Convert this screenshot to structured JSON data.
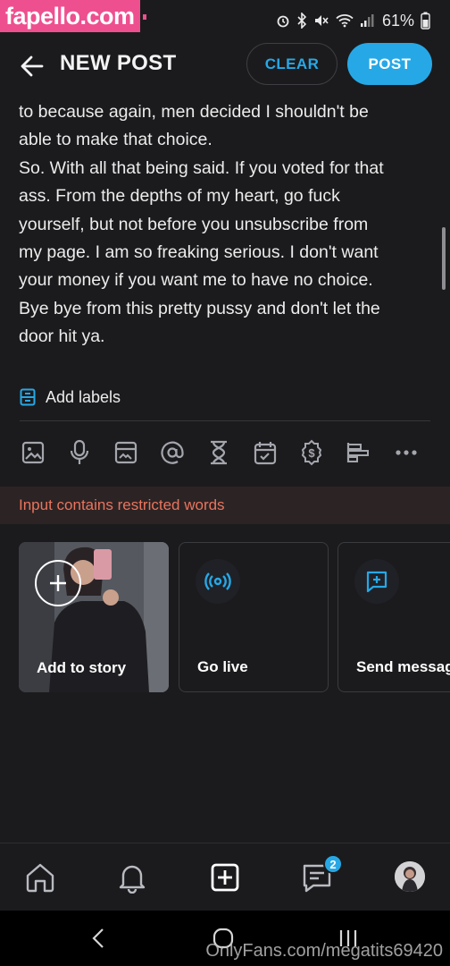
{
  "watermark": {
    "site": "fapello.com",
    "account": "OnlyFans.com/megatits69420"
  },
  "status_bar": {
    "battery": "61%"
  },
  "header": {
    "title": "NEW POST",
    "clear_label": "CLEAR",
    "post_label": "POST"
  },
  "post_text": {
    "lines": [
      "to because again, men decided I shouldn't be",
      "able to make that choice.",
      "So. With all that being said. If you voted for that",
      "ass. From the depths of my heart, go fuck",
      "yourself, but not before you unsubscribe from",
      "my page. I am so freaking serious. I don't want",
      "your money if you want me to have no choice.",
      "Bye bye from this pretty pussy and don't let the",
      "door hit ya."
    ]
  },
  "add_labels": "Add labels",
  "toolbar_icons": [
    "image-icon",
    "microphone-icon",
    "vault-icon",
    "mention-icon",
    "hourglass-icon",
    "calendar-icon",
    "price-icon",
    "poll-icon",
    "more-icon"
  ],
  "warning": "Input contains restricted words",
  "cards": {
    "story": "Add to story",
    "live": "Go live",
    "message": "Send message"
  },
  "bottom_nav": {
    "messages_badge": "2"
  },
  "colors": {
    "accent": "#27a8e6",
    "background": "#1b1b1d",
    "warning_text": "#e8755e",
    "watermark_pink": "#ee4f8f"
  }
}
